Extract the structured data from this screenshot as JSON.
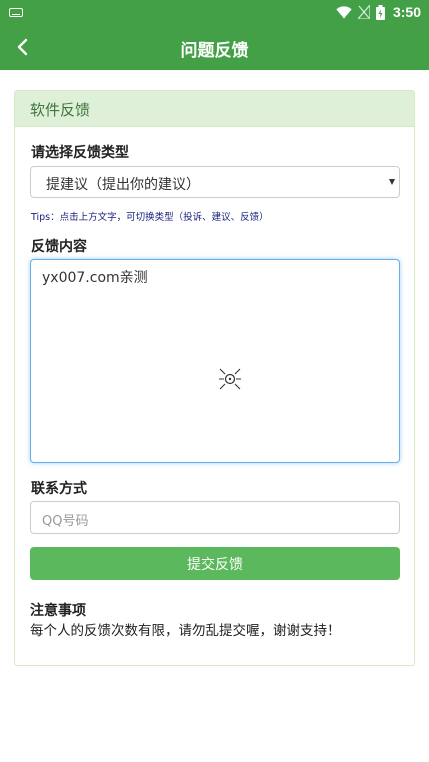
{
  "status_bar": {
    "time": "3:50",
    "icons": [
      "keyboard-icon",
      "wifi-icon",
      "signal-icon",
      "battery-icon"
    ]
  },
  "app_bar": {
    "title": "问题反馈",
    "back_icon": "chevron-left-icon"
  },
  "panel": {
    "heading": "软件反馈",
    "type_label": "请选择反馈类型",
    "type_selected": "提建议（提出你的建议）",
    "tips": "Tips：点击上方文字，可切换类型（投诉、建议、反馈）",
    "content_label": "反馈内容",
    "content_value": "yx007.com亲测",
    "contact_label": "联系方式",
    "contact_placeholder": "QQ号码",
    "submit_label": "提交反馈",
    "notice_title": "注意事项",
    "notice_text": "每个人的反馈次数有限，请勿乱提交喔，谢谢支持！"
  },
  "colors": {
    "primary": "#43a047",
    "panel_header_bg": "#dff0d8",
    "panel_header_text": "#3c763d",
    "button": "#5cb85c",
    "tips_text": "#1a237e",
    "focus_border": "#66afe9"
  }
}
